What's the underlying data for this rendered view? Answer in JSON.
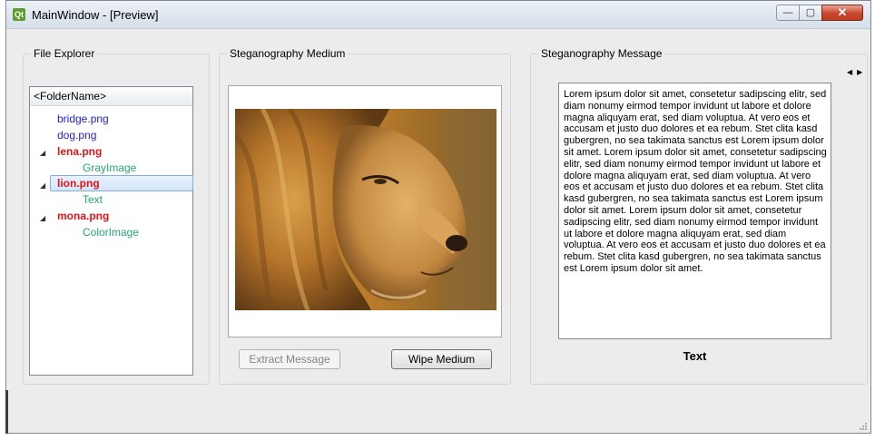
{
  "window": {
    "title": "MainWindow - [Preview]",
    "app_icon": "qt-icon",
    "minimize_label": "—",
    "maximize_label": "▢",
    "close_label": "✕"
  },
  "file_explorer": {
    "title": "File Explorer",
    "header": "<FolderName>",
    "items": [
      {
        "label": "bridge.png",
        "color": "#1e1ec8",
        "bold": false,
        "expandable": false,
        "child": false
      },
      {
        "label": "dog.png",
        "color": "#1e1ec8",
        "bold": false,
        "expandable": false,
        "child": false
      },
      {
        "label": "lena.png",
        "color": "#e0151b",
        "bold": true,
        "expandable": true,
        "child": false
      },
      {
        "label": "GrayImage",
        "color": "#26a578",
        "bold": false,
        "expandable": false,
        "child": true
      },
      {
        "label": "lion.png",
        "color": "#e0151b",
        "bold": true,
        "expandable": true,
        "child": false,
        "selected": true
      },
      {
        "label": "Text",
        "color": "#26a578",
        "bold": false,
        "expandable": false,
        "child": true
      },
      {
        "label": "mona.png",
        "color": "#e0151b",
        "bold": true,
        "expandable": true,
        "child": false
      },
      {
        "label": "ColorImage",
        "color": "#26a578",
        "bold": false,
        "expandable": false,
        "child": true
      }
    ]
  },
  "medium": {
    "title": "Steganography Medium",
    "extract_label": "Extract Message",
    "wipe_label": "Wipe Medium"
  },
  "message": {
    "title": "Steganography Message",
    "body": "Lorem ipsum dolor sit amet, consetetur sadipscing elitr, sed diam nonumy eirmod tempor invidunt ut labore et dolore magna aliquyam erat, sed diam voluptua. At vero eos et accusam et justo duo dolores et ea rebum. Stet clita kasd gubergren, no sea takimata sanctus est Lorem ipsum dolor sit amet. Lorem ipsum dolor sit amet, consetetur sadipscing elitr,  sed diam nonumy eirmod tempor invidunt ut labore et dolore magna aliquyam erat, sed diam voluptua. At vero eos et accusam et justo duo dolores et ea rebum. Stet clita kasd gubergren, no sea takimata sanctus est Lorem ipsum dolor sit amet. Lorem ipsum dolor sit amet, consetetur sadipscing elitr,  sed diam nonumy eirmod tempor invidunt ut labore et dolore magna aliquyam erat, sed diam voluptua. At vero eos et accusam et justo duo dolores et ea rebum. Stet clita kasd gubergren, no sea takimata sanctus est Lorem ipsum dolor sit amet.",
    "type_label": "Text",
    "prev_arrow": "◀",
    "next_arrow": "▶"
  }
}
